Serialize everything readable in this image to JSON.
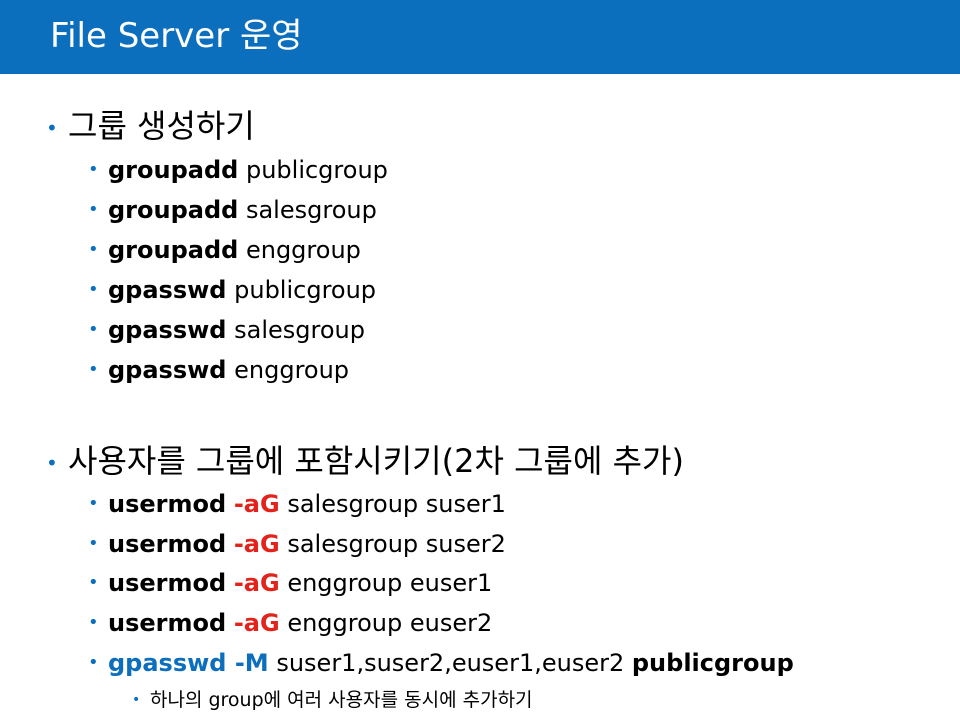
{
  "title": "File Server 운영",
  "section1": {
    "heading": "그룹 생성하기",
    "items": [
      {
        "cmd": "groupadd",
        "arg": "publicgroup"
      },
      {
        "cmd": "groupadd",
        "arg": "salesgroup"
      },
      {
        "cmd": "groupadd",
        "arg": "enggroup"
      },
      {
        "cmd": "gpasswd",
        "arg": "publicgroup"
      },
      {
        "cmd": "gpasswd",
        "arg": "salesgroup"
      },
      {
        "cmd": "gpasswd",
        "arg": "enggroup"
      }
    ]
  },
  "section2": {
    "heading": "사용자를 그룹에 포함시키기(2차 그룹에 추가)",
    "items": [
      {
        "cmd": "usermod",
        "opt": "-aG",
        "arg": "salesgroup suser1"
      },
      {
        "cmd": "usermod",
        "opt": "-aG",
        "arg": "salesgroup suser2"
      },
      {
        "cmd": "usermod",
        "opt": "-aG",
        "arg": "enggroup euser1"
      },
      {
        "cmd": "usermod",
        "opt": "-aG",
        "arg": "enggroup euser2"
      }
    ],
    "gpasswd_line": {
      "cmd": "gpasswd -M",
      "arg": "suser1,suser2,euser1,euser2",
      "group": "publicgroup"
    },
    "note": "하나의 group에 여러 사용자를 동시에 추가하기"
  },
  "bullet_glyph": "•",
  "colors": {
    "header_bg": "#0b6fbe",
    "bullet": "#0b6fbe",
    "option_red": "#e3231b",
    "command_blue": "#0b6fbe"
  }
}
